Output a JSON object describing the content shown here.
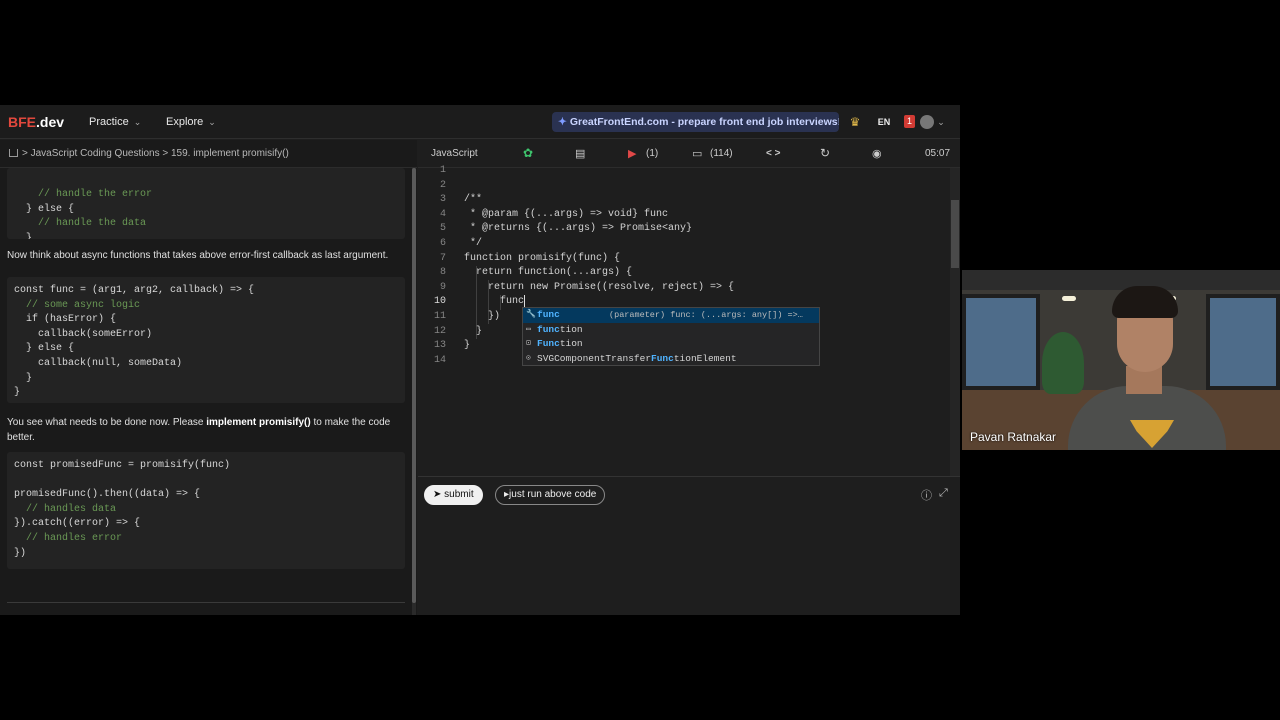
{
  "header": {
    "logo_main": "BFE",
    "logo_suffix": ".dev",
    "nav": [
      {
        "label": "Practice"
      },
      {
        "label": "Explore"
      }
    ],
    "promo": "GreatFrontEnd.com - prepare front end job interviews!",
    "lang": "EN",
    "notifications": "1"
  },
  "breadcrumb": {
    "section": "JavaScript Coding Questions",
    "sep": ">",
    "current": "159. implement promisify()"
  },
  "problem": {
    "code1": [
      "    // handle the error",
      "  } else {",
      "    // handle the data",
      "  }",
      "}"
    ],
    "para1": "Now think about async functions that takes above error-first callback as last argument.",
    "code2": [
      "const func = (arg1, arg2, callback) => {",
      "  // some async logic",
      "  if (hasError) {",
      "    callback(someError)",
      "  } else {",
      "    callback(null, someData)",
      "  }",
      "}"
    ],
    "para2_pre": "You see what needs to be done now. Please ",
    "para2_bold": "implement promisify()",
    "para2_post": " to make the code better.",
    "code3": [
      "const promisedFunc = promisify(func)",
      "",
      "promisedFunc().then((data) => {",
      "  // handles data",
      "}).catch((error) => {",
      "  // handles error",
      "})"
    ]
  },
  "editor_toolbar": {
    "language": "JavaScript",
    "video_count": "(1)",
    "comments_count": "(114)",
    "code_icon": "< >",
    "timer": "05:07"
  },
  "editor": {
    "line_numbers": [
      "1",
      "2",
      "3",
      "4",
      "5",
      "6",
      "7",
      "8",
      "9",
      "10",
      "11",
      "12",
      "13",
      "14"
    ],
    "current_line": "10",
    "lines": [
      "",
      "",
      "/**",
      " * @param {(...args) => void} func",
      " * @returns {(...args) => Promise<any}",
      " */",
      "function promisify(func) {",
      "  return function(...args) {",
      "    return new Promise((resolve, reject) => {",
      "      func",
      "    })",
      "  }",
      "}",
      ""
    ]
  },
  "autocomplete": [
    {
      "icon": "wrench-icon",
      "pre": "",
      "match": "func",
      "post": "",
      "detail": "(parameter) func: (...args: any[]) =>…",
      "selected": true
    },
    {
      "icon": "keyword-icon",
      "pre": "",
      "match": "func",
      "post": "tion",
      "detail": "",
      "selected": false
    },
    {
      "icon": "class-icon",
      "pre": "",
      "match": "Func",
      "post": "tion",
      "detail": "",
      "selected": false
    },
    {
      "icon": "interface-icon",
      "pre": "SVGComponentTransfer",
      "match": "Func",
      "post": "tionElement",
      "detail": "",
      "selected": false
    }
  ],
  "actions": {
    "submit": "submit",
    "run": "just run above code"
  },
  "webcam": {
    "name": "Pavan Ratnakar"
  },
  "colors": {
    "brand_red": "#e2483d",
    "promo_bg": "#2a3251",
    "selected_suggestion": "#04395e"
  }
}
